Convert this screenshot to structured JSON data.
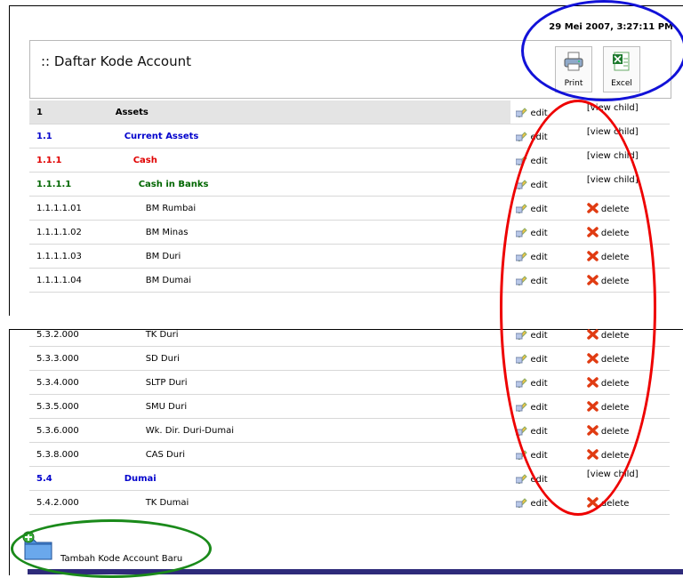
{
  "timestamp": "29 Mei 2007, 3:27:11 PM",
  "page_title": ":: Daftar Kode Account",
  "toolbar": {
    "print_label": "Print",
    "excel_label": "Excel"
  },
  "actions": {
    "edit": "edit",
    "delete": "delete",
    "view_child": "[view child]"
  },
  "top_rows": [
    {
      "code": "1",
      "name": "Assets",
      "level": "header",
      "child": true
    },
    {
      "code": "1.1",
      "name": "Current Assets",
      "level": "blue",
      "child": true
    },
    {
      "code": "1.1.1",
      "name": "Cash",
      "level": "red",
      "child": true
    },
    {
      "code": "1.1.1.1",
      "name": "Cash in Banks",
      "level": "green",
      "child": true
    },
    {
      "code": "1.1.1.1.01",
      "name": "BM Rumbai",
      "level": "leaf",
      "child": false
    },
    {
      "code": "1.1.1.1.02",
      "name": "BM Minas",
      "level": "leaf",
      "child": false
    },
    {
      "code": "1.1.1.1.03",
      "name": "BM Duri",
      "level": "leaf",
      "child": false
    },
    {
      "code": "1.1.1.1.04",
      "name": "BM Dumai",
      "level": "leaf",
      "child": false
    }
  ],
  "bottom_rows": [
    {
      "code": "5.3.2.000",
      "name": "TK Duri",
      "level": "leaf",
      "child": false
    },
    {
      "code": "5.3.3.000",
      "name": "SD Duri",
      "level": "leaf",
      "child": false
    },
    {
      "code": "5.3.4.000",
      "name": "SLTP Duri",
      "level": "leaf",
      "child": false
    },
    {
      "code": "5.3.5.000",
      "name": "SMU Duri",
      "level": "leaf",
      "child": false
    },
    {
      "code": "5.3.6.000",
      "name": "Wk. Dir. Duri-Dumai",
      "level": "leaf",
      "child": false
    },
    {
      "code": "5.3.8.000",
      "name": "CAS Duri",
      "level": "leaf",
      "child": false
    },
    {
      "code": "5.4",
      "name": "Dumai",
      "level": "blue",
      "child": true
    },
    {
      "code": "5.4.2.000",
      "name": "TK Dumai",
      "level": "leaf",
      "child": false
    }
  ],
  "add_button": {
    "label": "Tambah Kode Account Baru"
  },
  "colors": {
    "blue": "#0000cc",
    "red": "#e00000",
    "green": "#006600",
    "header_bg": "#e4e4e4",
    "bar": "#2e2b7a"
  }
}
